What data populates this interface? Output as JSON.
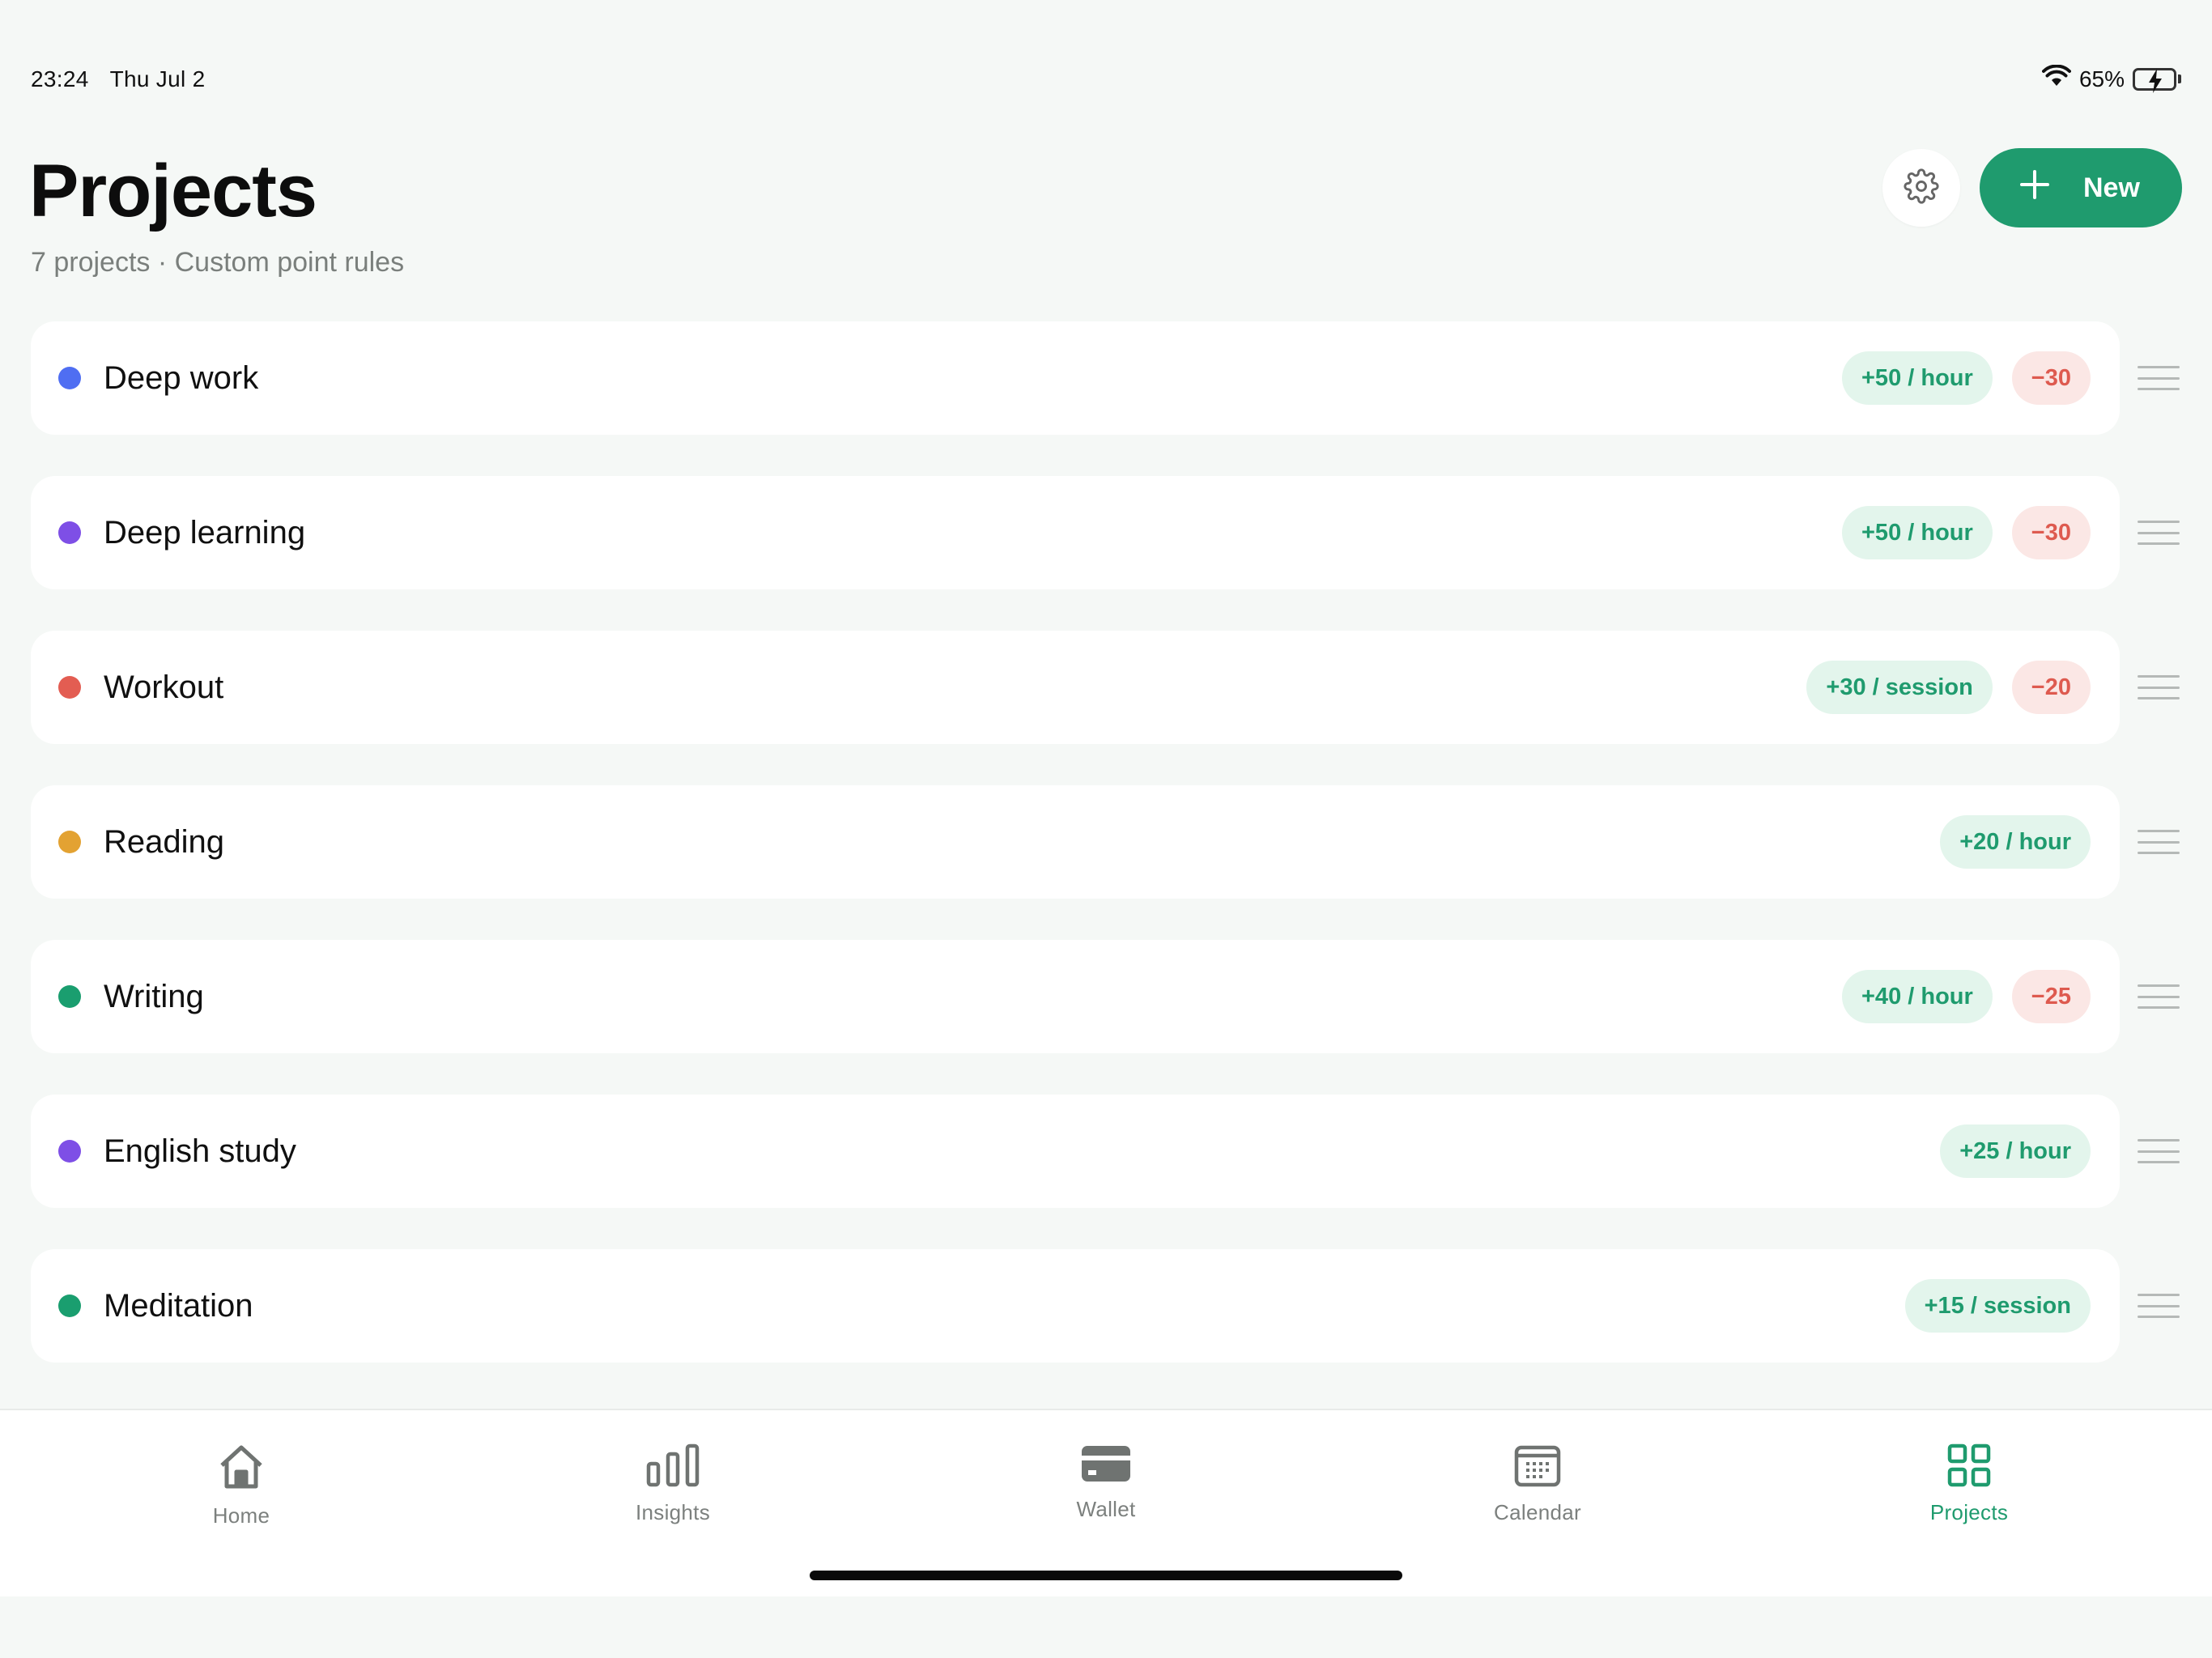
{
  "status_bar": {
    "time": "23:24",
    "date": "Thu Jul 2",
    "battery_text": "65%",
    "battery_level": 0.65,
    "icons": [
      "wifi-icon",
      "battery-charging-icon"
    ]
  },
  "header": {
    "title": "Projects",
    "subtitle": "7 projects · Custom point rules",
    "settings_icon": "gear-icon",
    "new_button_label": "New",
    "new_button_icon": "plus-icon"
  },
  "colors": {
    "accent": "#1f9b6e",
    "positive_badge_bg": "#e3f5ec",
    "negative_badge_bg": "#fbe7e5",
    "negative_text": "#de5a4f"
  },
  "projects": [
    {
      "name": "Deep work",
      "color": "#4f6ef2",
      "reward": "+50 / hour",
      "penalty": "−30"
    },
    {
      "name": "Deep learning",
      "color": "#7e4fe6",
      "reward": "+50 / hour",
      "penalty": "−30"
    },
    {
      "name": "Workout",
      "color": "#e35d52",
      "reward": "+30 / session",
      "penalty": "−20"
    },
    {
      "name": "Reading",
      "color": "#e3a232",
      "reward": "+20 / hour",
      "penalty": ""
    },
    {
      "name": "Writing",
      "color": "#1a9e6f",
      "reward": "+40 / hour",
      "penalty": "−25"
    },
    {
      "name": "English study",
      "color": "#7e4fe6",
      "reward": "+25 / hour",
      "penalty": ""
    },
    {
      "name": "Meditation",
      "color": "#1a9e6f",
      "reward": "+15 / session",
      "penalty": ""
    }
  ],
  "tabs": [
    {
      "label": "Home",
      "icon": "home-icon",
      "active": false
    },
    {
      "label": "Insights",
      "icon": "bar-chart-icon",
      "active": false
    },
    {
      "label": "Wallet",
      "icon": "wallet-icon",
      "active": false
    },
    {
      "label": "Calendar",
      "icon": "calendar-icon",
      "active": false
    },
    {
      "label": "Projects",
      "icon": "grid-icon",
      "active": true
    }
  ]
}
